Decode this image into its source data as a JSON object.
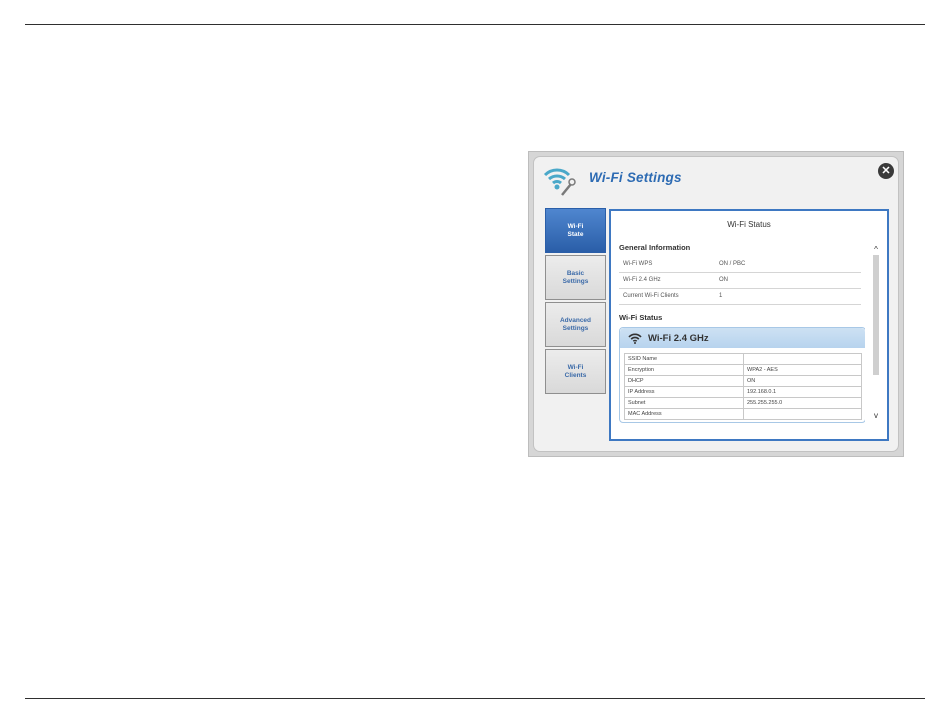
{
  "dialog": {
    "title": "Wi-Fi Settings",
    "close_label": "✕",
    "logo_icon": "wifi-wrench-icon"
  },
  "tabs": [
    {
      "label": "Wi-Fi\nState",
      "active": true
    },
    {
      "label": "Basic\nSettings",
      "active": false
    },
    {
      "label": "Advanced\nSettings",
      "active": false
    },
    {
      "label": "Wi-Fi\nClients",
      "active": false
    }
  ],
  "panel": {
    "title": "Wi-Fi Status",
    "general": {
      "heading": "General Information",
      "rows": [
        {
          "key": "Wi-Fi WPS",
          "value": "ON / PBC"
        },
        {
          "key": "Wi-Fi 2.4 GHz",
          "value": "ON"
        },
        {
          "key": "Current Wi-Fi Clients",
          "value": "1"
        }
      ]
    },
    "status": {
      "heading": "Wi-Fi Status",
      "band_title": "Wi-Fi 2.4 GHz",
      "rows": [
        {
          "key": "SSID Name",
          "value": ""
        },
        {
          "key": "Encryption",
          "value": "WPA2 - AES"
        },
        {
          "key": "DHCP",
          "value": "ON"
        },
        {
          "key": "IP Address",
          "value": "192.168.0.1"
        },
        {
          "key": "Subnet",
          "value": "255.255.255.0"
        },
        {
          "key": "MAC Address",
          "value": ""
        }
      ]
    },
    "scroll_up": "^",
    "scroll_down": "v"
  },
  "colors": {
    "accent": "#2d6bb3",
    "panel_border": "#3e78c2",
    "active_tab": "#2a5ea8"
  }
}
